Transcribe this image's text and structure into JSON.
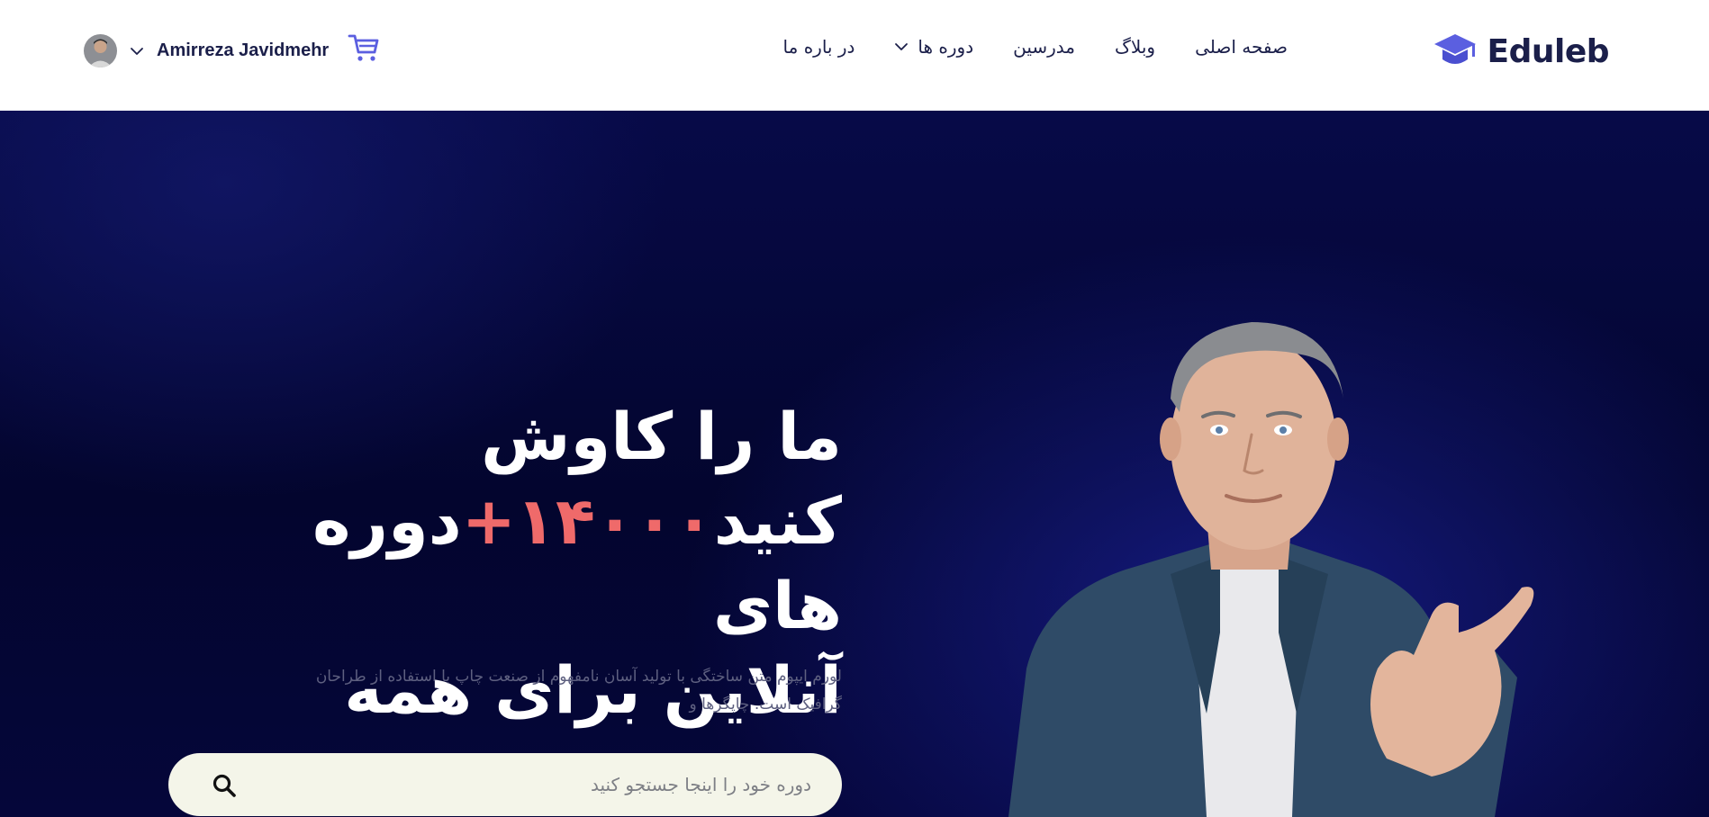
{
  "header": {
    "logo_text": "Eduleb",
    "nav": [
      {
        "label": "صفحه اصلی",
        "has_dropdown": false
      },
      {
        "label": "در باره ما",
        "has_dropdown": false
      },
      {
        "label": "دوره ها",
        "has_dropdown": true
      },
      {
        "label": "مدرسین",
        "has_dropdown": false
      },
      {
        "label": "وبلاگ",
        "has_dropdown": false
      }
    ],
    "user_name": "Amirreza Javidmehr",
    "icons": {
      "logo": "graduation-cap-icon",
      "cart": "cart-icon",
      "user_dropdown": "chevron-down-icon"
    }
  },
  "hero": {
    "headline_line1": "ما را کاوش",
    "headline_line2_a": "کنید",
    "headline_line2_accent": "۱۴۰۰۰+",
    "headline_line2_b": "دوره های",
    "headline_line3": "آنلاین برای همه",
    "description": "لورم ایپوم متن ساختگی با تولید آسان نامفهوم از صنعت چاپ با استفاده از طراحان گرافیک است. چاپگرها و",
    "search_placeholder": "دوره خود را اینجا جستجو کنید",
    "search_icon": "search-icon"
  },
  "colors": {
    "brand": "#5b5fe0",
    "navy": "#1b1f4a",
    "accent": "#ef6a6a",
    "hero_bg": "#03052e",
    "search_bg": "#f4f5e9"
  }
}
